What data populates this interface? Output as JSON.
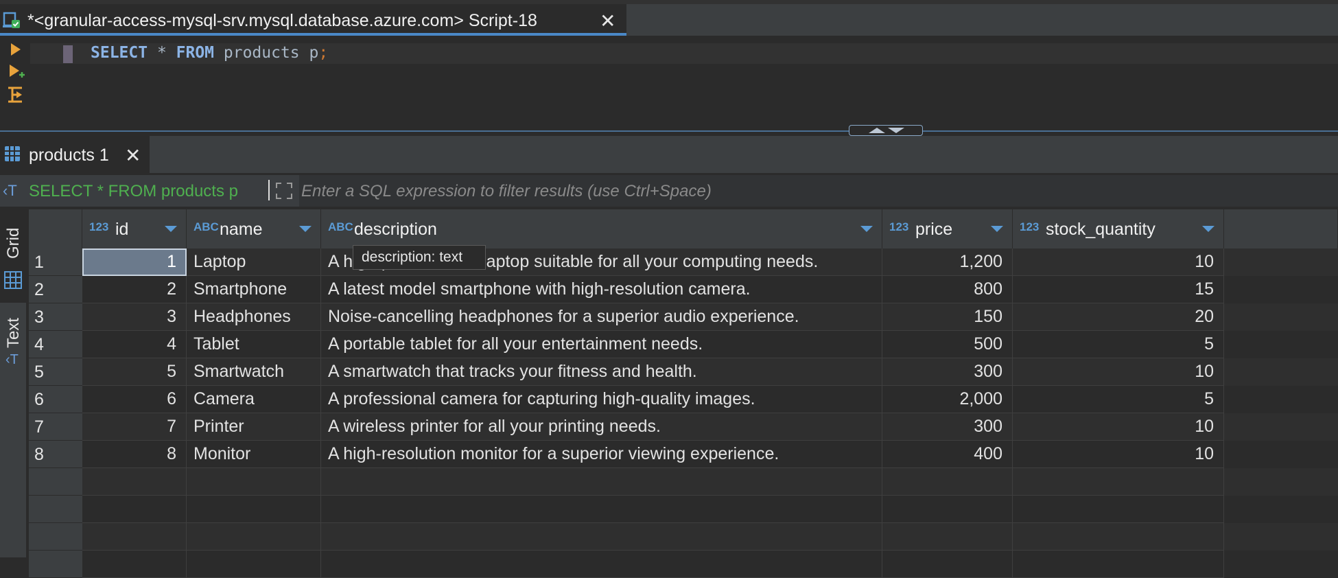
{
  "editor_tab": {
    "title": "*<granular-access-mysql-srv.mysql.database.azure.com> Script-18",
    "close": "✕"
  },
  "editor": {
    "code": {
      "kw1": "SELECT",
      "star": " * ",
      "kw2": "FROM",
      "rest": " products p",
      "semi": ";"
    },
    "gutter": [
      {
        "name": "run-statement",
        "icon": "play-icon"
      },
      {
        "name": "run-script",
        "icon": "play-plus-icon"
      },
      {
        "name": "explain-plan",
        "icon": "explain-plan-icon"
      }
    ]
  },
  "result_tab": {
    "label": "products 1",
    "close": "✕"
  },
  "filter": {
    "query": "SELECT * FROM products p",
    "placeholder": "Enter a SQL expression to filter results (use Ctrl+Space)"
  },
  "side_tabs": [
    "Grid",
    "Text"
  ],
  "columns": [
    {
      "type": "123",
      "name": "id"
    },
    {
      "type": "ABC",
      "name": "name"
    },
    {
      "type": "ABC",
      "name": "description"
    },
    {
      "type": "123",
      "name": "price"
    },
    {
      "type": "123",
      "name": "stock_quantity"
    }
  ],
  "rows": [
    {
      "n": "1",
      "id": "1",
      "name": "Laptop",
      "description": "A high-performance laptop suitable for all your computing needs.",
      "price": "1,200",
      "stock": "10"
    },
    {
      "n": "2",
      "id": "2",
      "name": "Smartphone",
      "description": "A latest model smartphone with high-resolution camera.",
      "price": "800",
      "stock": "15"
    },
    {
      "n": "3",
      "id": "3",
      "name": "Headphones",
      "description": "Noise-cancelling headphones for a superior audio experience.",
      "price": "150",
      "stock": "20"
    },
    {
      "n": "4",
      "id": "4",
      "name": "Tablet",
      "description": "A portable tablet for all your entertainment needs.",
      "price": "500",
      "stock": "5"
    },
    {
      "n": "5",
      "id": "5",
      "name": "Smartwatch",
      "description": "A smartwatch that tracks your fitness and health.",
      "price": "300",
      "stock": "10"
    },
    {
      "n": "6",
      "id": "6",
      "name": "Camera",
      "description": "A professional camera for capturing high-quality images.",
      "price": "2,000",
      "stock": "5"
    },
    {
      "n": "7",
      "id": "7",
      "name": "Printer",
      "description": "A wireless printer for all your printing needs.",
      "price": "300",
      "stock": "10"
    },
    {
      "n": "8",
      "id": "8",
      "name": "Monitor",
      "description": "A high-resolution monitor for a superior viewing experience.",
      "price": "400",
      "stock": "10"
    }
  ],
  "tooltip": "description: text",
  "colors": {
    "accent": "#4a88c7",
    "type_tag": "#5b9bd5",
    "filter_query": "#4fb04f",
    "selected_cell": "#6b7a8c"
  }
}
